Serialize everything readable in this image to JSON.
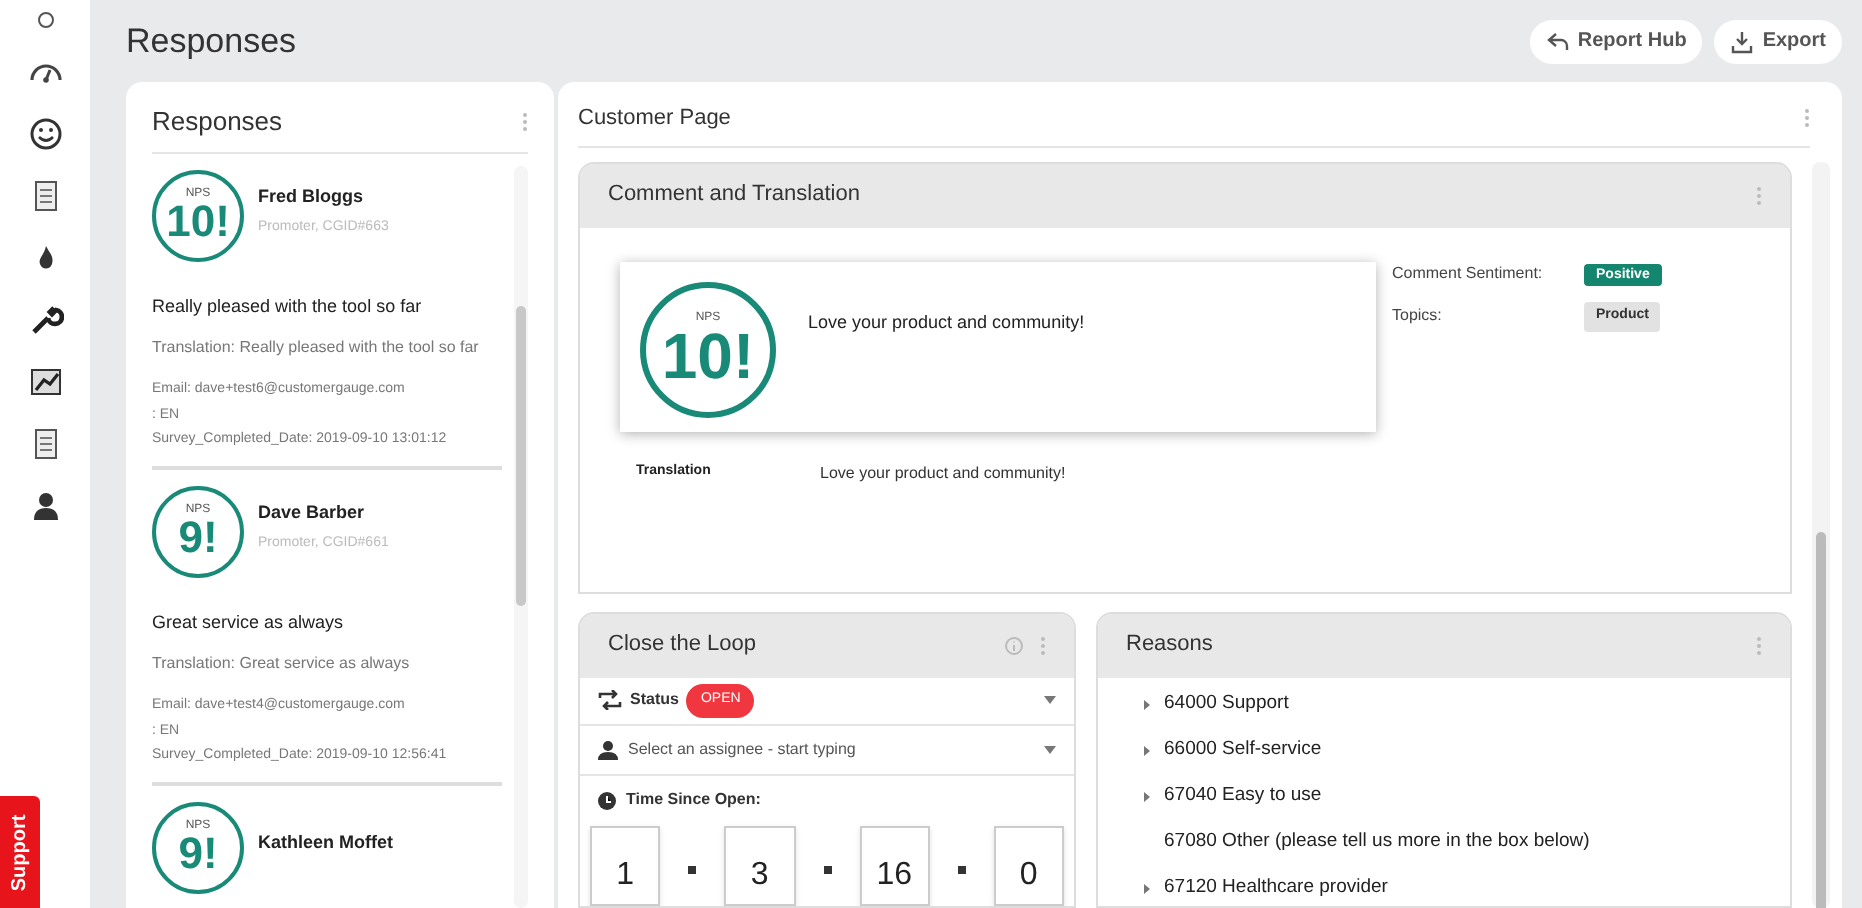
{
  "page_title": "Responses",
  "header_buttons": [
    {
      "kind": "report",
      "label": "Report Hub"
    },
    {
      "kind": "export",
      "label": "Export"
    }
  ],
  "sidebar": {
    "items": [
      {
        "kind": "dot",
        "selected": false
      },
      {
        "kind": "gauge",
        "selected": false
      },
      {
        "kind": "smile",
        "selected": false
      },
      {
        "kind": "doc",
        "selected": false
      },
      {
        "kind": "flame",
        "selected": false
      },
      {
        "kind": "wrench",
        "selected": false
      },
      {
        "kind": "chart",
        "selected": false
      },
      {
        "kind": "doc",
        "selected": false
      },
      {
        "kind": "user",
        "selected": false
      }
    ],
    "support": "Support"
  },
  "responses_panel": {
    "title": "Responses",
    "items": [
      {
        "nps_label": "NPS",
        "score": "10!",
        "name": "Fred Bloggs",
        "meta": "Promoter, CGID#663",
        "comment": "Really pleased with the tool so far",
        "translation": "Translation: Really pleased with the tool so far",
        "details": [
          "Email: dave+test6@customergauge.com",
          ": EN",
          "Survey_Completed_Date: 2019-09-10 13:01:12"
        ]
      },
      {
        "nps_label": "NPS",
        "score": "9!",
        "name": "Dave Barber",
        "meta": "Promoter, CGID#661",
        "comment": "Great service as always",
        "translation": "Translation: Great service as always",
        "details": [
          "Email: dave+test4@customergauge.com",
          ": EN",
          "Survey_Completed_Date: 2019-09-10 12:56:41"
        ]
      },
      {
        "nps_label": "NPS",
        "score": "9!",
        "name": "Kathleen Moffet"
      }
    ]
  },
  "customer_page": {
    "title": "Customer Page",
    "comment": {
      "title": "Comment and Translation",
      "nps_label": "NPS",
      "score": "10!",
      "text": "Love your product and community!",
      "sentiment_label": "Comment Sentiment:",
      "sentiment": "Positive",
      "topics_label": "Topics:",
      "topics": [
        "Product"
      ],
      "translation_label": "Translation",
      "translation": "Love your product and community!"
    },
    "close_loop": {
      "title": "Close the Loop",
      "status_label": "Status",
      "status": "OPEN",
      "assignee_placeholder": "Select an assignee - start typing",
      "time_label": "Time Since Open:",
      "time": [
        "1",
        "3",
        "16",
        "0"
      ]
    },
    "reasons": {
      "title": "Reasons",
      "items": [
        {
          "label": "64000 Support",
          "expandable": true
        },
        {
          "label": "66000 Self-service",
          "expandable": true
        },
        {
          "label": "67040 Easy to use",
          "expandable": true
        },
        {
          "label": "67080 Other (please tell us more in the box below)",
          "expandable": false
        },
        {
          "label": "67120 Healthcare provider",
          "expandable": true
        }
      ]
    }
  }
}
